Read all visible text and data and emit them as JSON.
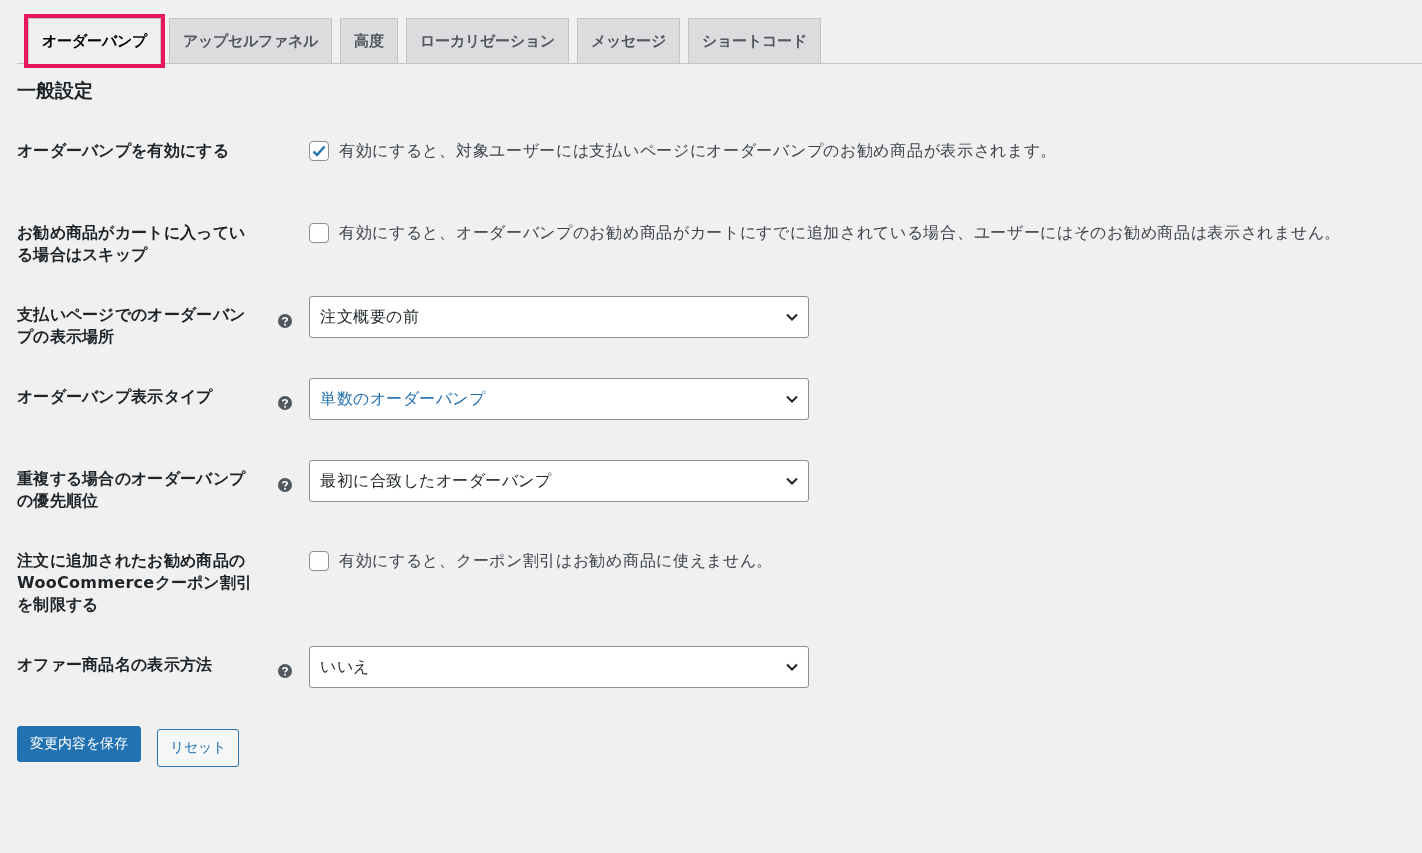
{
  "tabs": [
    {
      "label": "オーダーバンプ",
      "selected": true,
      "highlighted": true
    },
    {
      "label": "アップセルファネル",
      "selected": false,
      "highlighted": false
    },
    {
      "label": "高度",
      "selected": false,
      "highlighted": false
    },
    {
      "label": "ローカリゼーション",
      "selected": false,
      "highlighted": false
    },
    {
      "label": "メッセージ",
      "selected": false,
      "highlighted": false
    },
    {
      "label": "ショートコード",
      "selected": false,
      "highlighted": false
    }
  ],
  "section_title": "一般設定",
  "settings": [
    {
      "kind": "checkbox",
      "label": "オーダーバンプを有効にする",
      "checked": true,
      "description": "有効にすると、対象ユーザーには支払いページにオーダーバンプのお勧め商品が表示されます。"
    },
    {
      "kind": "checkbox",
      "label": "お勧め商品がカートに入っている場合はスキップ",
      "checked": false,
      "description": "有効にすると、オーダーバンプのお勧め商品がカートにすでに追加されている場合、ユーザーにはそのお勧め商品は表示されません。"
    },
    {
      "kind": "select",
      "label": "支払いページでのオーダーバンプの表示場所",
      "value": "注文概要の前",
      "focused": false
    },
    {
      "kind": "select",
      "label": "オーダーバンプ表示タイプ",
      "value": "単数のオーダーバンプ",
      "focused": true
    },
    {
      "kind": "select",
      "label": "重複する場合のオーダーバンプの優先順位",
      "value": "最初に合致したオーダーバンプ",
      "focused": false
    },
    {
      "kind": "checkbox",
      "label": "注文に追加されたお勧め商品のWooCommerceクーポン割引を制限する",
      "checked": false,
      "description": "有効にすると、クーポン割引はお勧め商品に使えません。"
    },
    {
      "kind": "select",
      "label": "オファー商品名の表示方法",
      "value": "いいえ",
      "focused": false
    }
  ],
  "buttons": [
    {
      "label": "変更内容を保存",
      "kind": "primary"
    },
    {
      "label": "リセット",
      "kind": "secondary"
    }
  ]
}
